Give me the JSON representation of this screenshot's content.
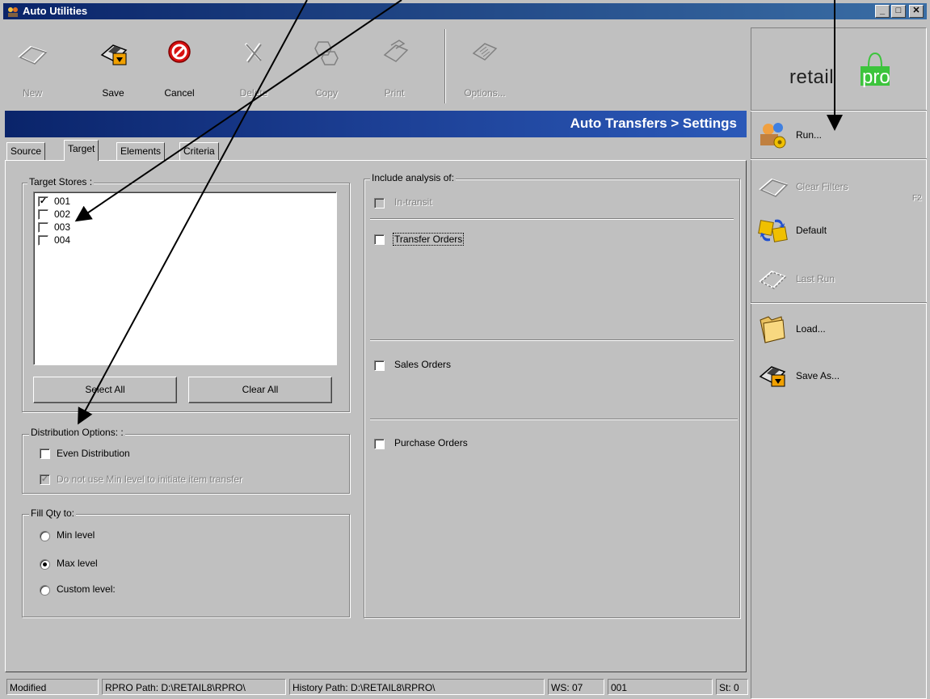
{
  "window": {
    "title": "Auto Utilities",
    "controls": {
      "minimize": "_",
      "maximize": "□",
      "close": "✕"
    }
  },
  "toolbar": {
    "new": "New",
    "save": "Save",
    "cancel": "Cancel",
    "delete": "Delete",
    "copy": "Copy",
    "print": "Print",
    "options": "Options..."
  },
  "header": {
    "title": "Auto Transfers > Settings"
  },
  "tabs": [
    "Source",
    "Target",
    "Elements",
    "Criteria"
  ],
  "target_stores": {
    "label": "Target Stores :",
    "stores": [
      {
        "name": "001",
        "checked": true
      },
      {
        "name": "002",
        "checked": false
      },
      {
        "name": "003",
        "checked": false
      },
      {
        "name": "004",
        "checked": false
      }
    ],
    "select_all": "Select All",
    "clear_all": "Clear All"
  },
  "distribution": {
    "label": "Distribution Options: :",
    "even": "Even Distribution",
    "min_level": "Do not use Min level to initiate item transfer"
  },
  "fill_qty": {
    "label": "Fill Qty to:",
    "options": [
      "Min level",
      "Max level",
      "Custom level:"
    ],
    "selected": "Max level"
  },
  "analysis": {
    "label": "Include analysis of:",
    "in_transit": "In-transit",
    "transfer_orders": "Transfer Orders",
    "sales_orders": "Sales Orders",
    "purchase_orders": "Purchase Orders"
  },
  "brand": {
    "part1": "retail",
    "part2": "pro"
  },
  "side_actions": {
    "run": "Run...",
    "clear_filters": "Clear Filters",
    "clear_filters_key": "F2",
    "default": "Default",
    "last_run": "Last Run",
    "load": "Load...",
    "save_as": "Save As..."
  },
  "status": {
    "state": "Modified",
    "rpro_path": "RPRO Path: D:\\RETAIL8\\RPRO\\",
    "history_path": "History Path: D:\\RETAIL8\\RPRO\\",
    "ws": "WS: 07",
    "store": "001",
    "st": "St: 0"
  },
  "colors": {
    "face": "#c0c0c0",
    "titlebar": "#0a246a",
    "brand_green": "#3cc43c"
  }
}
